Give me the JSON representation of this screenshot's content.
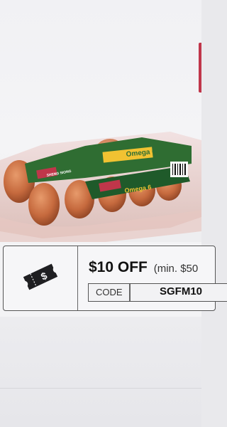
{
  "product": {
    "brand_label": "SHENG SIONG",
    "variant_label": "Omega 6",
    "image_alt": "egg-carton-image"
  },
  "coupon": {
    "amount": "$10 OFF",
    "condition": "(min. $50",
    "code_label": "CODE",
    "code_value": "SGFM10",
    "icon": "ticket-dollar-icon"
  },
  "colors": {
    "accent_red": "#c0364a",
    "carton_green": "#2e7d32",
    "egg_brown": "#c66a3e"
  }
}
